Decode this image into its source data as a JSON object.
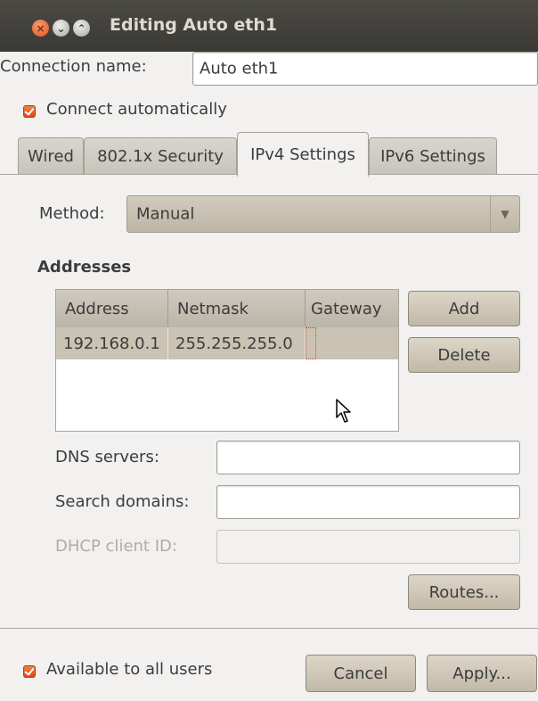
{
  "window": {
    "title": "Editing Auto eth1",
    "close_glyph": "×",
    "min_glyph": "⌄",
    "max_glyph": "⌃"
  },
  "connection": {
    "name_label": "Connection name:",
    "name_value": "Auto eth1",
    "auto_label": "Connect automatically",
    "auto_checked": true
  },
  "tabs": [
    "Wired",
    "802.1x Security",
    "IPv4 Settings",
    "IPv6 Settings"
  ],
  "active_tab": "IPv4 Settings",
  "method": {
    "label": "Method:",
    "value": "Manual",
    "arrow": "▼"
  },
  "addresses": {
    "heading": "Addresses",
    "columns": [
      "Address",
      "Netmask",
      "Gateway"
    ],
    "rows": [
      {
        "address": "192.168.0.1",
        "netmask": "255.255.255.0",
        "gateway": ""
      }
    ],
    "add_label": "Add",
    "delete_label": "Delete"
  },
  "dns": {
    "label": "DNS servers:",
    "value": ""
  },
  "search_domains": {
    "label": "Search domains:",
    "value": ""
  },
  "dhcp": {
    "label": "DHCP client ID:",
    "value": ""
  },
  "routes_label": "Routes...",
  "footer": {
    "available_label": "Available to all users",
    "available_checked": true,
    "cancel_label": "Cancel",
    "apply_label": "Apply..."
  },
  "colors": {
    "accent": "#e2521d",
    "titlebar": "#3c3b37",
    "window_bg": "#f2f1f0"
  }
}
